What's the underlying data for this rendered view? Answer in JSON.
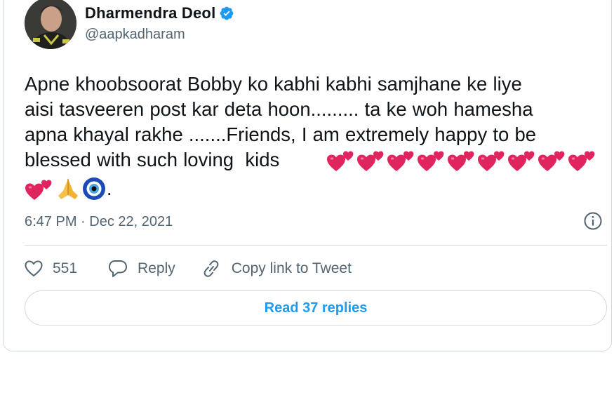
{
  "author": {
    "display_name": "Dharmendra Deol",
    "handle": "@aapkadharam",
    "verified": true
  },
  "tweet": {
    "text": "Apne khoobsoorat Bobby ko kabhi kabhi samjhane ke liye\naisi tasveeren post kar deta hoon......... ta ke woh hamesha\napna khayal rakhe .......Friends, I am extremely happy to be\nblessed with such loving  kids",
    "trailing_text": ".",
    "emojis": [
      "two-hearts-emoji",
      "folded-hands-emoji",
      "nazar-amulet-emoji"
    ],
    "timestamp": "6:47 PM · Dec 22, 2021"
  },
  "actions": {
    "like_count": "551",
    "reply_label": "Reply",
    "copy_link_label": "Copy link to Tweet"
  },
  "read_replies_label": "Read 37 replies",
  "colors": {
    "accent": "#1d9bf0",
    "heart": "#e0245e",
    "muted": "#536471",
    "border": "#cfd9de"
  }
}
